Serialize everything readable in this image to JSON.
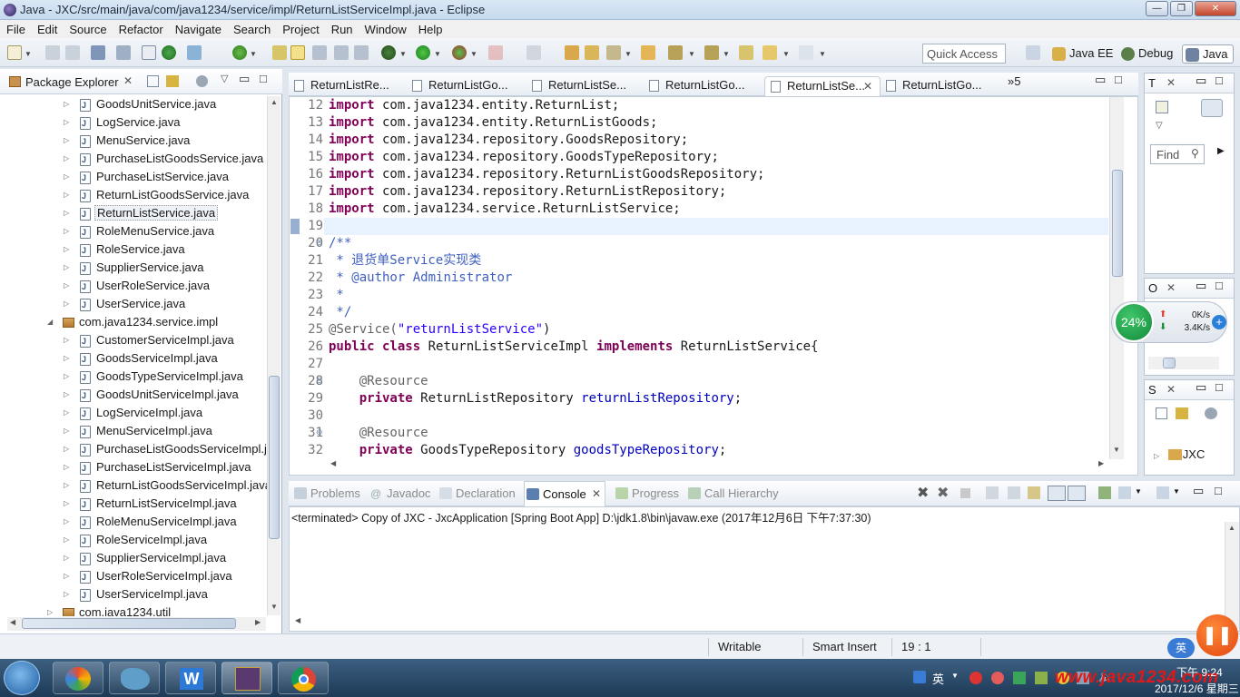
{
  "window": {
    "title": "Java - JXC/src/main/java/com/java1234/service/impl/ReturnListServiceImpl.java - Eclipse",
    "min_icon": "minimize-icon",
    "max_icon": "maximize-icon",
    "close_label": "✕"
  },
  "menu": [
    "File",
    "Edit",
    "Source",
    "Refactor",
    "Navigate",
    "Search",
    "Project",
    "Run",
    "Window",
    "Help"
  ],
  "toolbar": {
    "quick_access": "Quick Access",
    "perspectives": [
      "Java EE",
      "Debug",
      "Java"
    ]
  },
  "package_explorer": {
    "title": "Package Explorer",
    "service_items": [
      "GoodsUnitService.java",
      "LogService.java",
      "MenuService.java",
      "PurchaseListGoodsService.java",
      "PurchaseListService.java",
      "ReturnListGoodsService.java",
      "ReturnListService.java",
      "RoleMenuService.java",
      "RoleService.java",
      "SupplierService.java",
      "UserRoleService.java",
      "UserService.java"
    ],
    "impl_package": "com.java1234.service.impl",
    "impl_items": [
      "CustomerServiceImpl.java",
      "GoodsServiceImpl.java",
      "GoodsTypeServiceImpl.java",
      "GoodsUnitServiceImpl.java",
      "LogServiceImpl.java",
      "MenuServiceImpl.java",
      "PurchaseListGoodsServiceImpl.ja",
      "PurchaseListServiceImpl.java",
      "ReturnListGoodsServiceImpl.java",
      "ReturnListServiceImpl.java",
      "RoleMenuServiceImpl.java",
      "RoleServiceImpl.java",
      "SupplierServiceImpl.java",
      "UserRoleServiceImpl.java",
      "UserServiceImpl.java"
    ],
    "util_package": "com.java1234.util"
  },
  "editor_tabs": [
    "ReturnListRe...",
    "ReturnListGo...",
    "ReturnListSe...",
    "ReturnListGo...",
    "ReturnListSe...",
    "ReturnListGo..."
  ],
  "editor_tab_overflow": "»5",
  "code": [
    {
      "n": "12",
      "parts": [
        {
          "t": "import",
          "c": "kw"
        },
        {
          "t": " com.java1234.entity.ReturnList;",
          "c": ""
        }
      ]
    },
    {
      "n": "13",
      "parts": [
        {
          "t": "import",
          "c": "kw"
        },
        {
          "t": " com.java1234.entity.ReturnListGoods;",
          "c": ""
        }
      ]
    },
    {
      "n": "14",
      "parts": [
        {
          "t": "import",
          "c": "kw"
        },
        {
          "t": " com.java1234.repository.GoodsRepository;",
          "c": ""
        }
      ]
    },
    {
      "n": "15",
      "parts": [
        {
          "t": "import",
          "c": "kw"
        },
        {
          "t": " com.java1234.repository.GoodsTypeRepository;",
          "c": ""
        }
      ]
    },
    {
      "n": "16",
      "parts": [
        {
          "t": "import",
          "c": "kw"
        },
        {
          "t": " com.java1234.repository.ReturnListGoodsRepository;",
          "c": ""
        }
      ]
    },
    {
      "n": "17",
      "parts": [
        {
          "t": "import",
          "c": "kw"
        },
        {
          "t": " com.java1234.repository.ReturnListRepository;",
          "c": ""
        }
      ]
    },
    {
      "n": "18",
      "parts": [
        {
          "t": "import",
          "c": "kw"
        },
        {
          "t": " com.java1234.service.ReturnListService;",
          "c": ""
        }
      ]
    },
    {
      "n": "19",
      "parts": []
    },
    {
      "n": "20",
      "parts": [
        {
          "t": "/**",
          "c": "cmt"
        }
      ]
    },
    {
      "n": "21",
      "parts": [
        {
          "t": " * 退货单Service实现类",
          "c": "cmt"
        }
      ]
    },
    {
      "n": "22",
      "parts": [
        {
          "t": " * @author",
          "c": "cmt"
        },
        {
          "t": " Administrator",
          "c": "cmt"
        }
      ]
    },
    {
      "n": "23",
      "parts": [
        {
          "t": " *",
          "c": "cmt"
        }
      ]
    },
    {
      "n": "24",
      "parts": [
        {
          "t": " */",
          "c": "cmt"
        }
      ]
    },
    {
      "n": "25",
      "parts": [
        {
          "t": "@Service(",
          "c": "ann"
        },
        {
          "t": "\"returnListService\"",
          "c": "str"
        },
        {
          "t": ")",
          "c": ""
        }
      ]
    },
    {
      "n": "26",
      "parts": [
        {
          "t": "public class",
          "c": "kw"
        },
        {
          "t": " ReturnListServiceImpl ",
          "c": ""
        },
        {
          "t": "implements",
          "c": "kw"
        },
        {
          "t": " ReturnListService{",
          "c": ""
        }
      ]
    },
    {
      "n": "27",
      "parts": []
    },
    {
      "n": "28",
      "parts": [
        {
          "t": "    @Resource",
          "c": "ann"
        }
      ]
    },
    {
      "n": "29",
      "parts": [
        {
          "t": "    private",
          "c": "kw"
        },
        {
          "t": " ReturnListRepository ",
          "c": ""
        },
        {
          "t": "returnListRepository",
          "c": "fld"
        },
        {
          "t": ";",
          "c": ""
        }
      ]
    },
    {
      "n": "30",
      "parts": []
    },
    {
      "n": "31",
      "parts": [
        {
          "t": "    @Resource",
          "c": "ann"
        }
      ]
    },
    {
      "n": "32",
      "parts": [
        {
          "t": "    private",
          "c": "kw"
        },
        {
          "t": " GoodsTypeRepository ",
          "c": ""
        },
        {
          "t": "goodsTypeRepository",
          "c": "fld"
        },
        {
          "t": ";",
          "c": ""
        }
      ]
    }
  ],
  "right_panels": {
    "t_label": "T",
    "o_label": "O",
    "s_label": "S",
    "find": "Find",
    "project": "JXC"
  },
  "net_widget": {
    "percent": "24%",
    "up": "0K/s",
    "down": "3.4K/s"
  },
  "console": {
    "tabs": [
      "Problems",
      "Javadoc",
      "Declaration",
      "Console",
      "Progress",
      "Call Hierarchy"
    ],
    "active": "Console",
    "text": "<terminated> Copy of JXC - JxcApplication [Spring Boot App] D:\\jdk1.8\\bin\\javaw.exe (2017年12月6日 下午7:37:30)"
  },
  "status": {
    "writable": "Writable",
    "insert": "Smart Insert",
    "position": "19 : 1"
  },
  "taskbar": {
    "ime": "英",
    "time": "下午 9:24",
    "date": "2017/12/6 星期三",
    "watermark": "www.java1234.com"
  }
}
